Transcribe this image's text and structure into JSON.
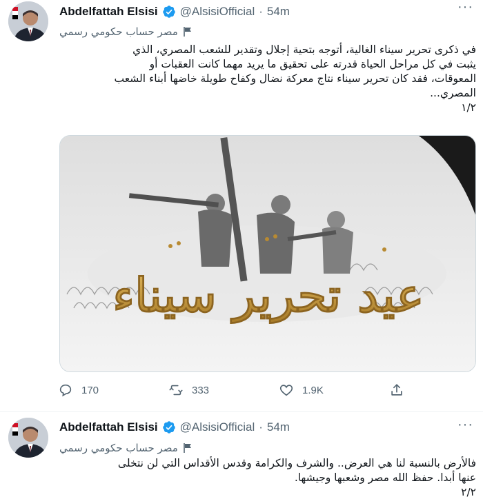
{
  "tweets": [
    {
      "author": {
        "name": "Abdelfattah Elsisi",
        "handle": "@AlsisiOfficial",
        "time": "54m"
      },
      "label": "مصر حساب حكومي رسمي",
      "text_lines": [
        "في ذكرى تحرير سيناء الغالية، أتوجه بتحية إجلال وتقدير للشعب المصري، الذي",
        "يثبت في كل مراحل الحياة قدرته على تحقيق ما يريد مهما كانت العقبات أو",
        "المعوقات، فقد كان تحرير سيناء نتاج معركة نضال وكفاح طويلة خاضها أبناء الشعب",
        "المصري...",
        "١/٢"
      ],
      "media": {
        "calligraphy": "عيد تحرير سيناء"
      },
      "stats": {
        "replies": "170",
        "retweets": "333",
        "likes": "1.9K"
      }
    },
    {
      "author": {
        "name": "Abdelfattah Elsisi",
        "handle": "@AlsisiOfficial",
        "time": "54m"
      },
      "label": "مصر حساب حكومي رسمي",
      "text_lines": [
        "فالأرض بالنسبة لنا هي العرض.. والشرف والكرامة وقدس الأقداس التي لن نتخلى",
        "عنها أبدا. حفظ الله مصر وشعبها وجيشها.",
        "٢/٢"
      ]
    }
  ],
  "colors": {
    "text": "#0f1419",
    "secondary": "#536471",
    "verified": "#1d9bf0",
    "gold": "#c9993a"
  },
  "icons": [
    "verified-badge-icon",
    "government-flag-icon",
    "reply-icon",
    "retweet-icon",
    "like-icon",
    "share-icon"
  ]
}
